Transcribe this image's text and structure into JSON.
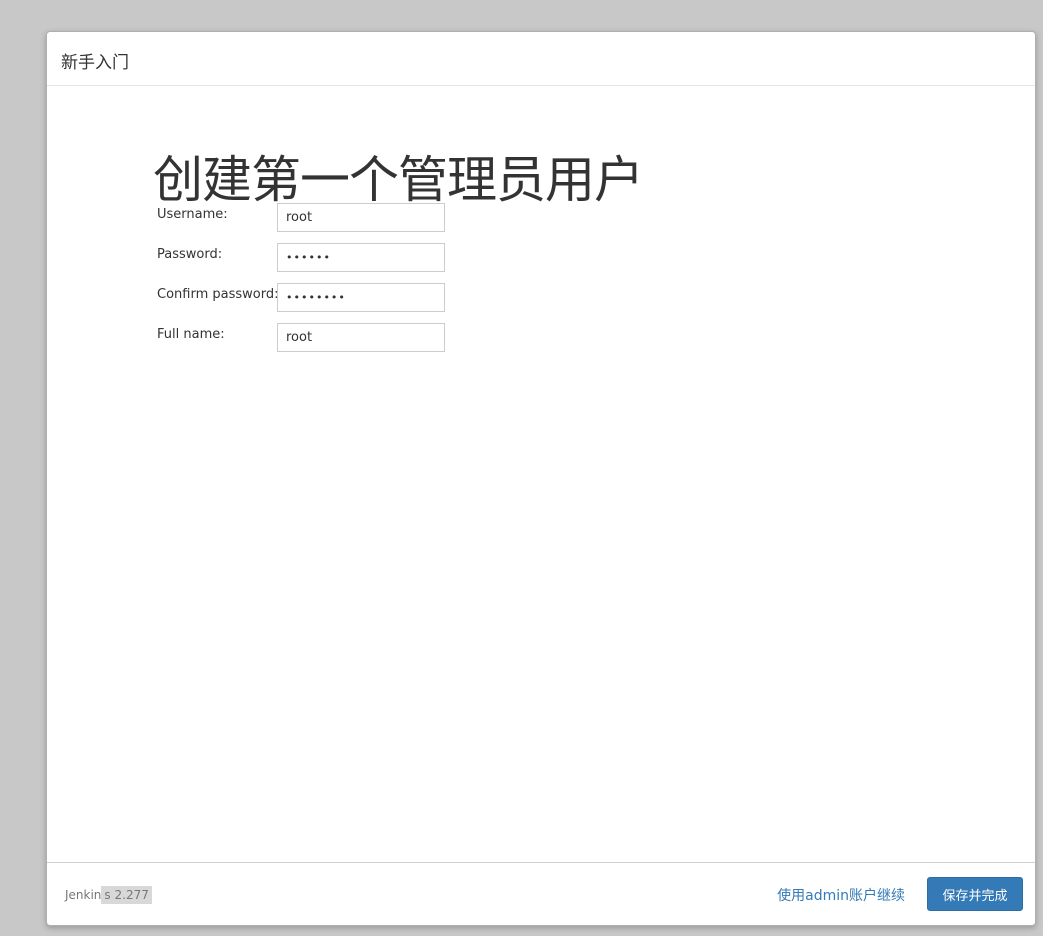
{
  "dialog": {
    "title": "新手入门"
  },
  "page": {
    "heading": "创建第一个管理员用户"
  },
  "form": {
    "username": {
      "label": "Username:",
      "value": "root"
    },
    "password": {
      "label": "Password:",
      "value": "••••••"
    },
    "confirm_password": {
      "label": "Confirm password:",
      "value": "••••••••"
    },
    "full_name": {
      "label": "Full name:",
      "value": "root"
    }
  },
  "footer": {
    "version_prefix": "Jenkin",
    "version_suffix": "s 2.277",
    "continue_link": "使用admin账户继续",
    "save_button": "保存并完成"
  },
  "colors": {
    "primary": "#337ab7",
    "backdrop": "#c8c8c8"
  }
}
